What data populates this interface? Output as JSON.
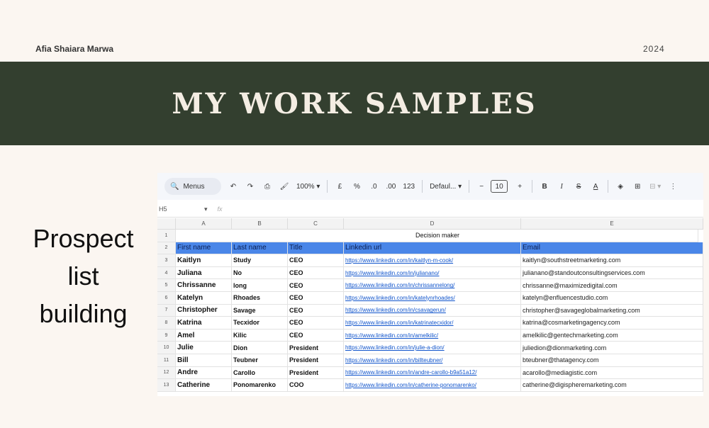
{
  "header": {
    "author": "Afia Shaiara Marwa",
    "year": "2024"
  },
  "banner": {
    "title": "MY WORK SAMPLES"
  },
  "side_label": "Prospect list building",
  "toolbar": {
    "menus_label": "Menus",
    "zoom": "100%",
    "currency": "£",
    "percent": "%",
    "dec_decrease": ".0",
    "dec_increase": ".00",
    "number_format": "123",
    "font": "Defaul...",
    "font_size": "10"
  },
  "formula_bar": {
    "cell_ref": "H5",
    "fx": "fx"
  },
  "columns": [
    "A",
    "B",
    "C",
    "D",
    "E"
  ],
  "merged_header": "Decision maker",
  "header_row": [
    "First name",
    "Last name",
    "Title",
    "Linkedin url",
    "Email"
  ],
  "rows": [
    {
      "n": "3",
      "first": "Kaitlyn",
      "last": "Study",
      "title": "CEO",
      "linkedin": "https://www.linkedin.com/in/kaitlyn-m-cook/",
      "email": "kaitlyn@southstreetmarketing.com"
    },
    {
      "n": "4",
      "first": "Juliana",
      "last": "No",
      "title": "CEO",
      "linkedin": "https://www.linkedin.com/in/julianano/",
      "email": "julianano@standoutconsultingservices.com"
    },
    {
      "n": "5",
      "first": "Chrissanne",
      "last": "long",
      "title": "CEO",
      "linkedin": "https://www.linkedin.com/in/chrissannelong/",
      "email": "chrissanne@maximizedigital.com"
    },
    {
      "n": "6",
      "first": "Katelyn",
      "last": "Rhoades",
      "title": "CEO",
      "linkedin": "https://www.linkedin.com/in/katelynrhoades/",
      "email": "katelyn@enfluencestudio.com"
    },
    {
      "n": "7",
      "first": "Christopher",
      "last": "Savage",
      "title": "CEO",
      "linkedin": "https://www.linkedin.com/in/csavagerun/",
      "email": "christopher@savageglobalmarketing.com"
    },
    {
      "n": "8",
      "first": "Katrina",
      "last": "Tecxidor",
      "title": "CEO",
      "linkedin": "https://www.linkedin.com/in/katrinatecxidor/",
      "email": "katrina@cosmarketingagency.com"
    },
    {
      "n": "9",
      "first": "Amel",
      "last": "Kilic",
      "title": "CEO",
      "linkedin": "https://www.linkedin.com/in/amelkilic/",
      "email": "amelkilic@gentechmarketing.com"
    },
    {
      "n": "10",
      "first": "Julie",
      "last": "Dion",
      "title": "President",
      "linkedin": "https://www.linkedin.com/in/julie-a-dion/",
      "email": "juliedion@dionmarketing.com"
    },
    {
      "n": "11",
      "first": "Bill",
      "last": "Teubner",
      "title": "President",
      "linkedin": "https://www.linkedin.com/in/billteubner/",
      "email": "bteubner@thatagency.com"
    },
    {
      "n": "12",
      "first": "Andre",
      "last": "Carollo",
      "title": "President",
      "linkedin": "https://www.linkedin.com/in/andre-carollo-b9a51a12/",
      "email": "acarollo@mediagistic.com"
    },
    {
      "n": "13",
      "first": "Catherine",
      "last": "Ponomarenko",
      "title": "COO",
      "linkedin": "https://www.linkedin.com/in/catherine-ponomarenko/",
      "email": "catherine@digispheremarketing.com"
    }
  ]
}
